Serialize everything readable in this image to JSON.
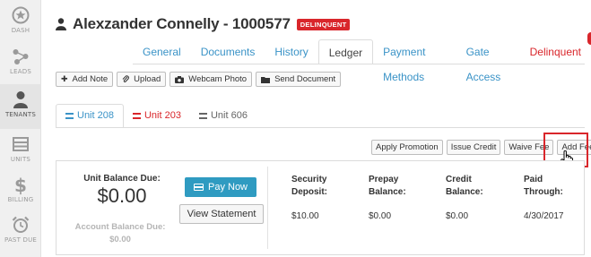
{
  "sidebar": {
    "items": [
      {
        "label": "DASH",
        "icon": "dashboard-icon"
      },
      {
        "label": "LEADS",
        "icon": "leads-icon"
      },
      {
        "label": "TENANTS",
        "icon": "tenant-icon"
      },
      {
        "label": "UNITS",
        "icon": "units-icon"
      },
      {
        "label": "BILLING",
        "icon": "dollar-icon"
      },
      {
        "label": "PAST DUE",
        "icon": "alarm-clock-icon"
      }
    ]
  },
  "header": {
    "tenant_name": "Alexzander Connelly - 1000577",
    "status_badge": "DELINQUENT"
  },
  "tabs": [
    {
      "label": "General"
    },
    {
      "label": "Documents"
    },
    {
      "label": "History"
    },
    {
      "label": "Ledger"
    },
    {
      "label": "Payment Methods"
    },
    {
      "label": "Gate Access"
    },
    {
      "label": "Delinquent"
    }
  ],
  "actions": {
    "add_note": "Add Note",
    "upload": "Upload",
    "webcam_photo": "Webcam Photo",
    "send_document": "Send Document"
  },
  "unit_tabs": [
    {
      "label": "Unit 208"
    },
    {
      "label": "Unit 203"
    },
    {
      "label": "Unit 606"
    }
  ],
  "fee_actions": {
    "apply_promotion": "Apply Promotion",
    "issue_credit": "Issue Credit",
    "waive_fee": "Waive Fee",
    "add_fee": "Add Fee"
  },
  "balance": {
    "unit_label": "Unit Balance Due:",
    "unit_amount": "$0.00",
    "account_label": "Account Balance Due:",
    "account_amount": "$0.00",
    "pay_now": "Pay Now",
    "view_statement": "View Statement"
  },
  "stats": {
    "security_deposit": {
      "label1": "Security",
      "label2": "Deposit:",
      "value": "$10.00"
    },
    "prepay_balance": {
      "label1": "Prepay",
      "label2": "Balance:",
      "value": "$0.00"
    },
    "credit_balance": {
      "label1": "Credit",
      "label2": "Balance:",
      "value": "$0.00"
    },
    "paid_through": {
      "label1": "Paid",
      "label2": "Through:",
      "value": "4/30/2017"
    }
  },
  "colors": {
    "accent_blue": "#3a93c7",
    "delinquent_red": "#d9262b",
    "pay_button": "#2f9bc1"
  }
}
